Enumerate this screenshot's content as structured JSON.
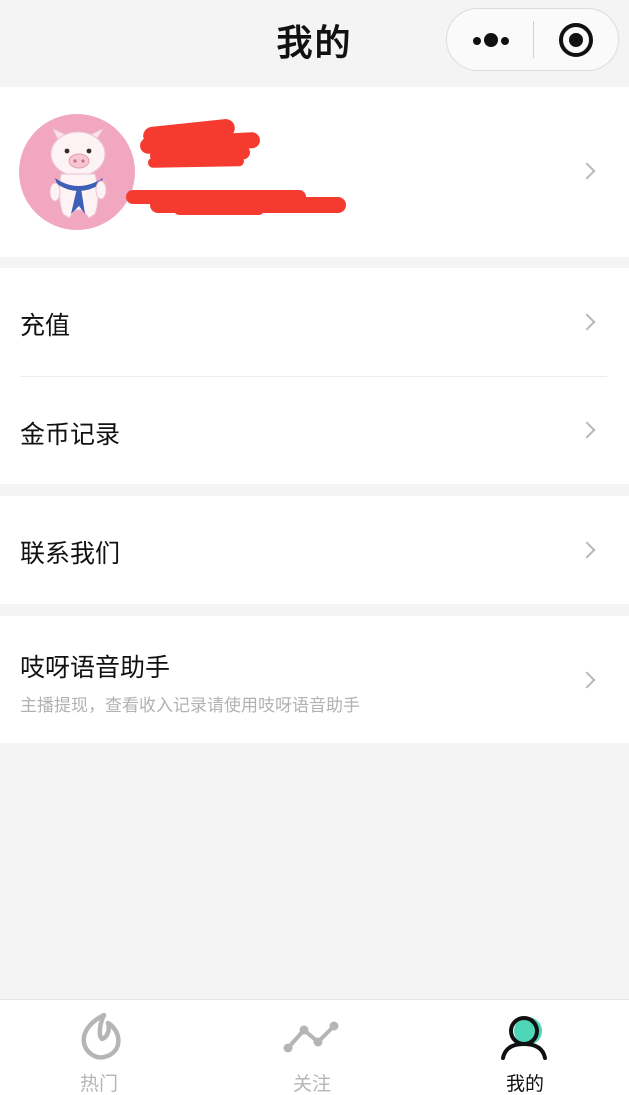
{
  "nav": {
    "title": "我的",
    "more_icon": "more-dots-icon",
    "close_icon": "target-close-icon"
  },
  "profile": {
    "avatar_icon": "pig-avatar",
    "name_redacted": true,
    "chevron_icon": "chevron-right-icon"
  },
  "menu": {
    "recharge": {
      "label": "充值"
    },
    "coin_records": {
      "label": "金币记录"
    },
    "contact_us": {
      "label": "联系我们"
    },
    "voice_assistant": {
      "label": "吱呀语音助手",
      "subtitle": "主播提现，查看收入记录请使用吱呀语音助手"
    }
  },
  "tabbar": {
    "tabs": [
      {
        "label": "热门",
        "icon": "flame-icon",
        "active": false
      },
      {
        "label": "关注",
        "icon": "trend-line-icon",
        "active": false
      },
      {
        "label": "我的",
        "icon": "user-icon",
        "active": true
      }
    ]
  },
  "colors": {
    "background": "#f4f4f4",
    "accent_teal": "#4fd6b8",
    "inactive": "#b5b5b5",
    "active_text": "#111111",
    "redaction": "#f53b2f"
  }
}
